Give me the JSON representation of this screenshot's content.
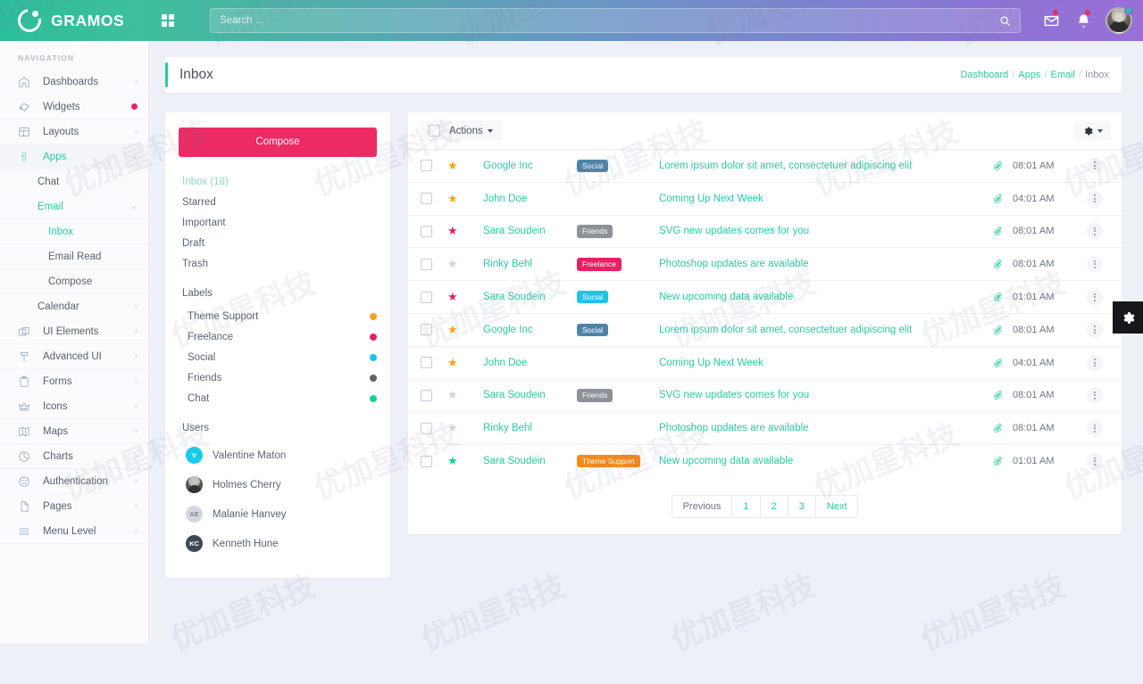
{
  "header": {
    "brand": "GRAMOS",
    "grid_icon": "grid-icon",
    "search": {
      "placeholder": "Search ...",
      "value": "",
      "icon": "search-icon"
    },
    "mail_icon": "envelope-icon",
    "bell_icon": "bell-icon",
    "avatar": "user-avatar",
    "status": "online"
  },
  "sidebar": {
    "title": "NAVIGATION",
    "items": [
      {
        "label": "Dashboards",
        "icon": "home-icon",
        "chevron": "›",
        "state": ""
      },
      {
        "label": "Widgets",
        "icon": "widgets-icon",
        "chevron": "",
        "badge_dot": true,
        "state": ""
      },
      {
        "label": "Layouts",
        "icon": "layouts-icon",
        "chevron": "›",
        "state": ""
      },
      {
        "label": "Apps",
        "icon": "apps-icon",
        "chevron": "⌄",
        "state": "active"
      },
      {
        "label": "UI Elements",
        "icon": "ui-elements-icon",
        "chevron": "›",
        "state": ""
      },
      {
        "label": "Advanced UI",
        "icon": "advanced-ui-icon",
        "chevron": "›",
        "state": ""
      },
      {
        "label": "Forms",
        "icon": "forms-icon",
        "chevron": "›",
        "state": ""
      },
      {
        "label": "Icons",
        "icon": "icons-icon",
        "chevron": "›",
        "state": ""
      },
      {
        "label": "Maps",
        "icon": "maps-icon",
        "chevron": "›",
        "state": ""
      },
      {
        "label": "Charts",
        "icon": "charts-icon",
        "chevron": "›",
        "state": ""
      },
      {
        "label": "Authentication",
        "icon": "authentication-icon",
        "chevron": "›",
        "state": ""
      },
      {
        "label": "Pages",
        "icon": "pages-icon",
        "chevron": "›",
        "state": ""
      },
      {
        "label": "Menu Level",
        "icon": "menu-level-icon",
        "chevron": "›",
        "state": ""
      }
    ],
    "apps_children": [
      {
        "label": "Chat",
        "chevron": "",
        "state": ""
      },
      {
        "label": "Email",
        "chevron": "⌄",
        "state": "act"
      },
      {
        "label": "Inbox",
        "chevron": "",
        "state": "act",
        "level": 2
      },
      {
        "label": "Email Read",
        "chevron": "",
        "state": "",
        "level": 2
      },
      {
        "label": "Compose",
        "chevron": "",
        "state": "",
        "level": 2
      },
      {
        "label": "Calendar",
        "chevron": "›",
        "state": ""
      }
    ]
  },
  "page": {
    "title": "Inbox",
    "breadcrumb": [
      "Dashboard",
      "Apps",
      "Email",
      "Inbox"
    ]
  },
  "mailnav": {
    "compose_label": "Compose",
    "folders": [
      {
        "label": "Inbox  (18)",
        "state": "act"
      },
      {
        "label": "Starred",
        "state": ""
      },
      {
        "label": "Important",
        "state": ""
      },
      {
        "label": "Draft",
        "state": ""
      },
      {
        "label": "Trash",
        "state": ""
      }
    ],
    "labels_title": "Labels",
    "labels": [
      {
        "label": "Theme Support",
        "color": "#f5a31f"
      },
      {
        "label": "Freelance",
        "color": "#ea1f63"
      },
      {
        "label": "Social",
        "color": "#1fc0e8"
      },
      {
        "label": "Friends",
        "color": "#5e636b"
      },
      {
        "label": "Chat",
        "color": "#19cf9b"
      }
    ],
    "users_title": "Users",
    "users": [
      {
        "name": "Valentine Maton",
        "initials": "V",
        "avatar": "letter",
        "color": "#17cbe8"
      },
      {
        "name": "Holmes Cherry",
        "initials": "",
        "avatar": "photo",
        "color": "#b6b3ad"
      },
      {
        "name": "Malanie Hanvey",
        "initials": "AE",
        "avatar": "letter",
        "color": "#d4d8de"
      },
      {
        "name": "Kenneth Hune",
        "initials": "KC",
        "avatar": "letter",
        "color": "#3e4655"
      }
    ]
  },
  "toolbar": {
    "select_all": "select-all-checkbox",
    "actions_label": "Actions",
    "settings_icon": "gear-icon"
  },
  "emails": [
    {
      "star": "orange",
      "from": "Google Inc",
      "tag": "Social",
      "tag_color": "#4f84a8",
      "subject": "Lorem ipsum dolor sit amet, consectetuer adipiscing elit",
      "time": "08:01 AM"
    },
    {
      "star": "orange",
      "from": "John Doe",
      "tag": "",
      "tag_color": "",
      "subject": "Coming Up Next Week",
      "time": "04:01 AM"
    },
    {
      "star": "pink",
      "from": "Sara Soudein",
      "tag": "Friends",
      "tag_color": "#8d9299",
      "subject": "SVG new updates comes for you",
      "time": "08:01 AM"
    },
    {
      "star": "gray",
      "from": "Rinky Behl",
      "tag": "Freelance",
      "tag_color": "#ea1f63",
      "subject": "Photoshop updates are available",
      "time": "08:01 AM"
    },
    {
      "star": "pink",
      "from": "Sara Soudein",
      "tag": "Social",
      "tag_color": "#22c2e8",
      "subject": "New upcoming data available",
      "time": "01:01 AM"
    },
    {
      "star": "orange",
      "from": "Google Inc",
      "tag": "Social",
      "tag_color": "#4f84a8",
      "subject": "Lorem ipsum dolor sit amet, consectetuer adipiscing elit",
      "time": "08:01 AM"
    },
    {
      "star": "orange",
      "from": "John Doe",
      "tag": "",
      "tag_color": "",
      "subject": "Coming Up Next Week",
      "time": "04:01 AM"
    },
    {
      "star": "gray",
      "from": "Sara Soudein",
      "tag": "Friends",
      "tag_color": "#8d9299",
      "subject": "SVG new updates comes for you",
      "time": "08:01 AM"
    },
    {
      "star": "gray",
      "from": "Rinky Behl",
      "tag": "",
      "tag_color": "",
      "subject": "Photoshop updates are available",
      "time": "08:01 AM"
    },
    {
      "star": "green",
      "from": "Sara Soudein",
      "tag": "Theme Support",
      "tag_color": "#f58a19",
      "subject": "New upcoming data available",
      "time": "01:01 AM"
    }
  ],
  "pagination": [
    "Previous",
    "1",
    "2",
    "3",
    "Next"
  ],
  "floating": {
    "gear_icon": "settings-gear-icon"
  },
  "watermark_text": "优加星科技",
  "colors": {
    "accent_green": "#2cc9a0",
    "accent_pink": "#ec2a63",
    "star_orange": "#f5a31f",
    "star_pink": "#ea1f63",
    "star_green": "#19cf9b",
    "star_gray": "#cdd2da"
  }
}
